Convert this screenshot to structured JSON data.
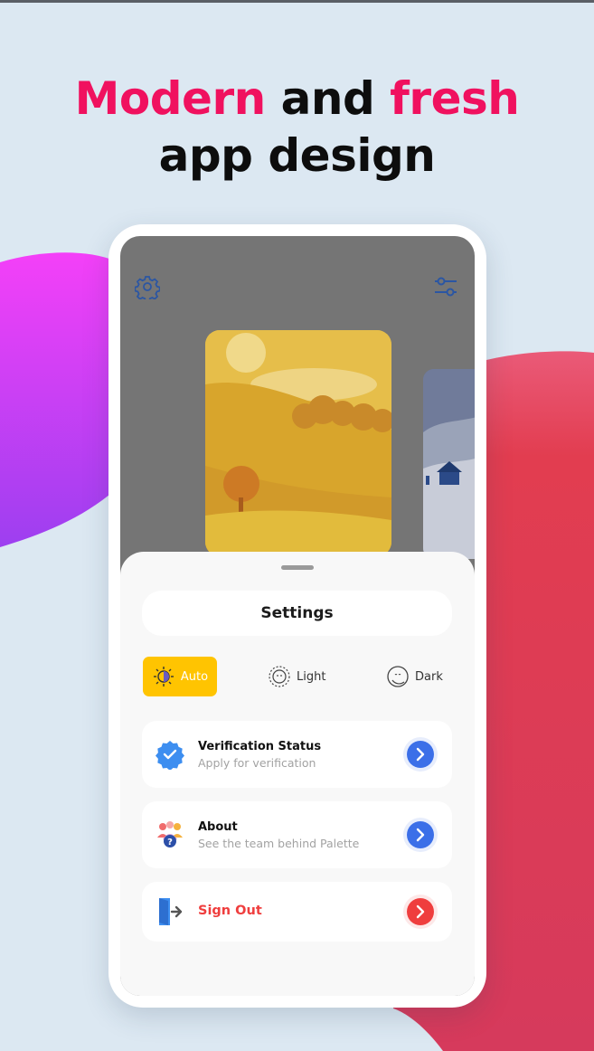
{
  "headline": {
    "line1_part1": "Modern",
    "line1_part2": " and ",
    "line1_part3": "fresh",
    "line2": "app design"
  },
  "colors": {
    "accent_pink": "#f0115f",
    "background": "#dce8f2",
    "auto_yellow": "#ffc401",
    "arrow_blue": "#3b6fe8",
    "signout_red": "#ef3e3e"
  },
  "phone": {
    "top_icons": [
      "gear-icon",
      "sliders-icon"
    ],
    "settings": {
      "title": "Settings",
      "theme_modes": [
        {
          "label": "Auto",
          "icon": "auto-theme-icon",
          "selected": true
        },
        {
          "label": "Light",
          "icon": "sun-icon",
          "selected": false
        },
        {
          "label": "Dark",
          "icon": "moon-icon",
          "selected": false
        }
      ],
      "items": [
        {
          "title": "Verification Status",
          "subtitle": "Apply for verification",
          "icon": "verified-badge-icon"
        },
        {
          "title": "About",
          "subtitle": "See the team behind Palette",
          "icon": "team-icon"
        },
        {
          "title": "Sign Out",
          "subtitle": "",
          "icon": "sign-out-icon"
        }
      ]
    }
  }
}
